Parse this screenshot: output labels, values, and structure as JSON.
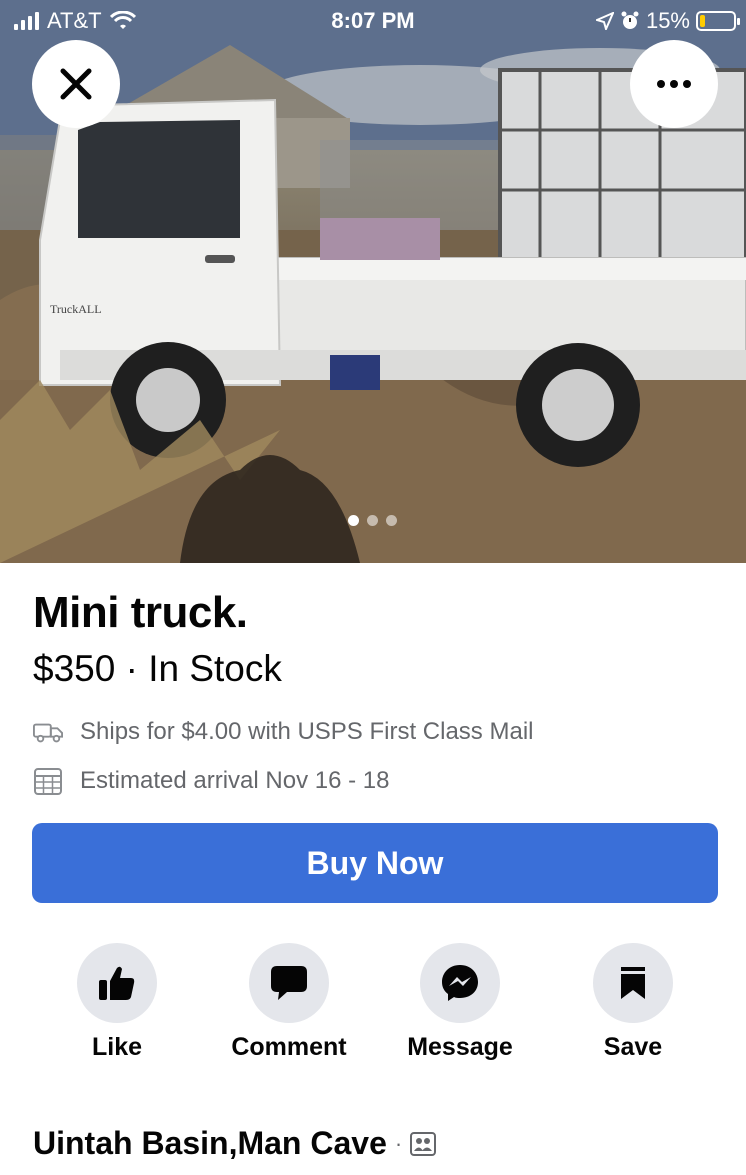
{
  "status_bar": {
    "carrier": "AT&T",
    "time": "8:07 PM",
    "battery": "15%",
    "icons": [
      "signal-bars-icon",
      "wifi-icon",
      "location-arrow-icon",
      "alarm-clock-icon",
      "battery-icon"
    ]
  },
  "photo": {
    "pager": {
      "total": 3,
      "current": 1
    },
    "truck_badge_text": "TruckALL"
  },
  "toolbar": {
    "close_icon": "close-icon",
    "more_icon": "more-horizontal-icon"
  },
  "listing": {
    "title": "Mini truck.",
    "price_line": "$350 · In Stock",
    "shipping": "Ships for $4.00 with USPS First Class Mail",
    "arrival": "Estimated arrival Nov 16 - 18"
  },
  "buy_button": {
    "label": "Buy Now",
    "color": "#3a6fd8"
  },
  "actions": [
    {
      "label": "Like",
      "icon": "thumbs-up-icon"
    },
    {
      "label": "Comment",
      "icon": "speech-bubble-icon"
    },
    {
      "label": "Message",
      "icon": "messenger-icon"
    },
    {
      "label": "Save",
      "icon": "bookmark-icon"
    }
  ],
  "seller": {
    "name": "Uintah Basin,Man Cave",
    "separator": "·",
    "icon": "group-icon"
  }
}
